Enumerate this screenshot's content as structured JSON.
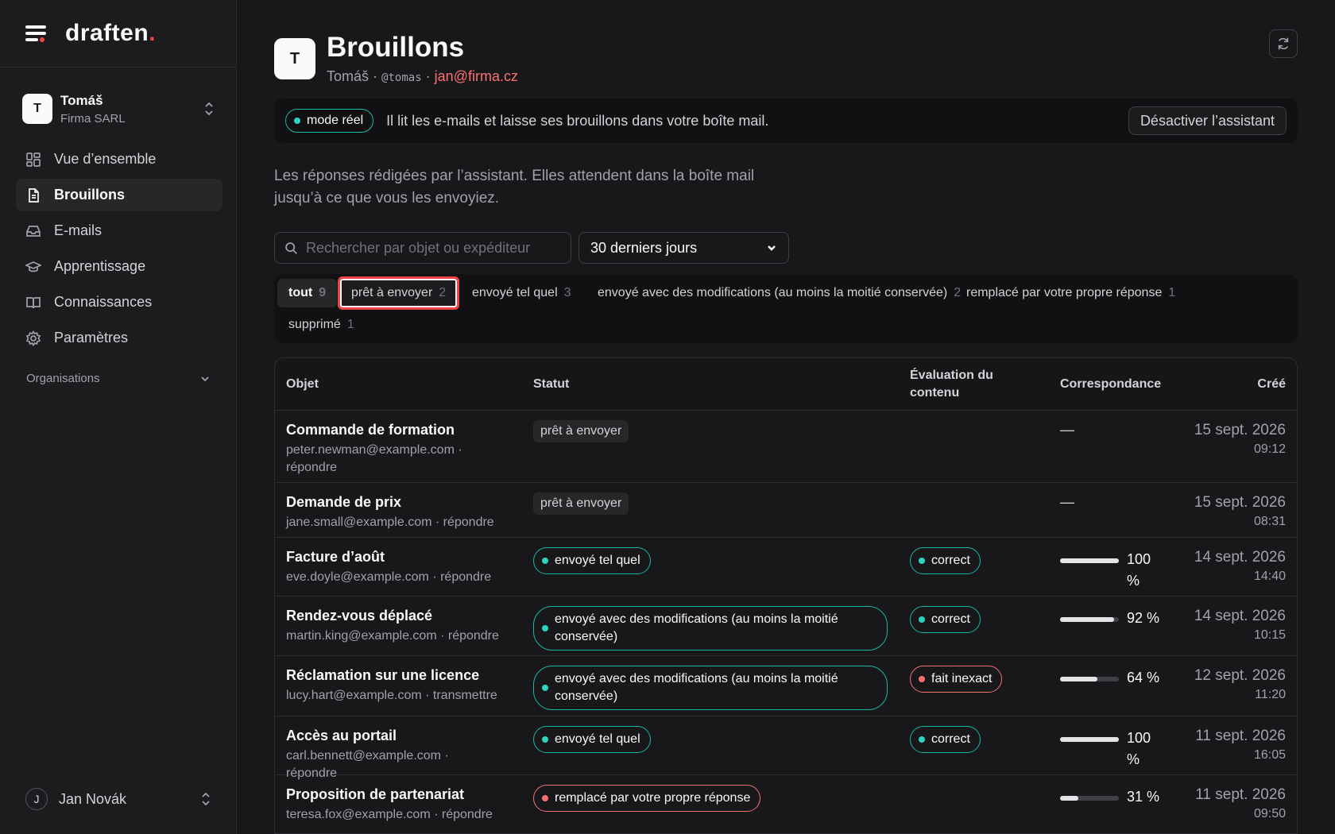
{
  "brand": {
    "name": "draften",
    "dot": "."
  },
  "account": {
    "initial": "T",
    "name": "Tomáš",
    "org": "Firma SARL"
  },
  "nav": [
    {
      "label": "Vue d’ensemble",
      "icon": "grid-icon"
    },
    {
      "label": "Brouillons",
      "icon": "document-icon",
      "active": true
    },
    {
      "label": "E-mails",
      "icon": "inbox-icon"
    },
    {
      "label": "Apprentissage",
      "icon": "graduation-cap-icon"
    },
    {
      "label": "Connaissances",
      "icon": "book-icon"
    },
    {
      "label": "Paramètres",
      "icon": "gear-icon"
    }
  ],
  "organisations_label": "Organisations",
  "user": {
    "initial": "J",
    "name": "Jan Novák"
  },
  "header": {
    "initial": "T",
    "title": "Brouillons",
    "name": "Tomáš",
    "sep": "·",
    "handle": "@tomas",
    "email": "jan@firma.cz"
  },
  "banner": {
    "mode": "mode réel",
    "text": "Il lit les e-mails et laisse ses brouillons dans votre boîte mail.",
    "button": "Désactiver l’assistant"
  },
  "intro": "Les réponses rédigées par l’assistant. Elles attendent dans la boîte mail jusqu’à ce que vous les envoyiez.",
  "search": {
    "placeholder": "Rechercher par objet ou expéditeur"
  },
  "period": {
    "selected": "30 derniers jours"
  },
  "filters": [
    {
      "label": "tout",
      "count": "9"
    },
    {
      "label": "prêt à envoyer",
      "count": "2"
    },
    {
      "label": "envoyé tel quel",
      "count": "3"
    },
    {
      "label": "envoyé avec des modifications (au moins la moitié conservée)",
      "count": "2"
    },
    {
      "label": "remplacé par votre propre réponse",
      "count": "1"
    },
    {
      "label": "supprimé",
      "count": "1"
    }
  ],
  "columns": {
    "subject": "Objet",
    "status": "Statut",
    "eval_line1": "Évaluation du",
    "eval_line2": "contenu",
    "match": "Correspondance",
    "created": "Créé"
  },
  "rows": [
    {
      "title": "Commande de formation",
      "meta1": "peter.newman@example.com ·",
      "meta2": "répondre",
      "status": "prêt à envoyer",
      "match_text": "—",
      "date": "15 sept. 2026",
      "time": "09:12"
    },
    {
      "title": "Demande de prix",
      "meta1": "jane.small@example.com · répondre",
      "status": "prêt à envoyer",
      "match_text": "—",
      "date": "15 sept. 2026",
      "time": "08:31"
    },
    {
      "title": "Facture d’août",
      "meta1": "eve.doyle@example.com · répondre",
      "status": "envoyé tel quel",
      "eval": "correct",
      "match": 100,
      "match_text1": "100",
      "match_text2": "%",
      "date": "14 sept. 2026",
      "time": "14:40"
    },
    {
      "title": "Rendez-vous déplacé",
      "meta1": "martin.king@example.com · répondre",
      "status1": "envoyé avec des modifications (au moins la moitié",
      "status2": "conservée)",
      "eval": "correct",
      "match": 92,
      "match_text1": "92 %",
      "date": "14 sept. 2026",
      "time": "10:15"
    },
    {
      "title": "Réclamation sur une licence",
      "meta1": "lucy.hart@example.com · transmettre",
      "status1": "envoyé avec des modifications (au moins la moitié",
      "status2": "conservée)",
      "eval": "fait inexact",
      "match": 64,
      "match_text1": "64 %",
      "date": "12 sept. 2026",
      "time": "11:20"
    },
    {
      "title": "Accès au portail",
      "meta1": "carl.bennett@example.com · répondre",
      "status": "envoyé tel quel",
      "eval": "correct",
      "match": 100,
      "match_text1": "100",
      "match_text2": "%",
      "date": "11 sept. 2026",
      "time": "16:05"
    },
    {
      "title": "Proposition de partenariat",
      "meta1": "teresa.fox@example.com · répondre",
      "status": "remplacé par votre propre réponse",
      "match": 31,
      "match_text1": "31 %",
      "date": "11 sept. 2026",
      "time": "09:50"
    }
  ],
  "colors": {
    "accent_red": "#ef4444",
    "teal": "#14b8a6",
    "background": "#18181b"
  }
}
